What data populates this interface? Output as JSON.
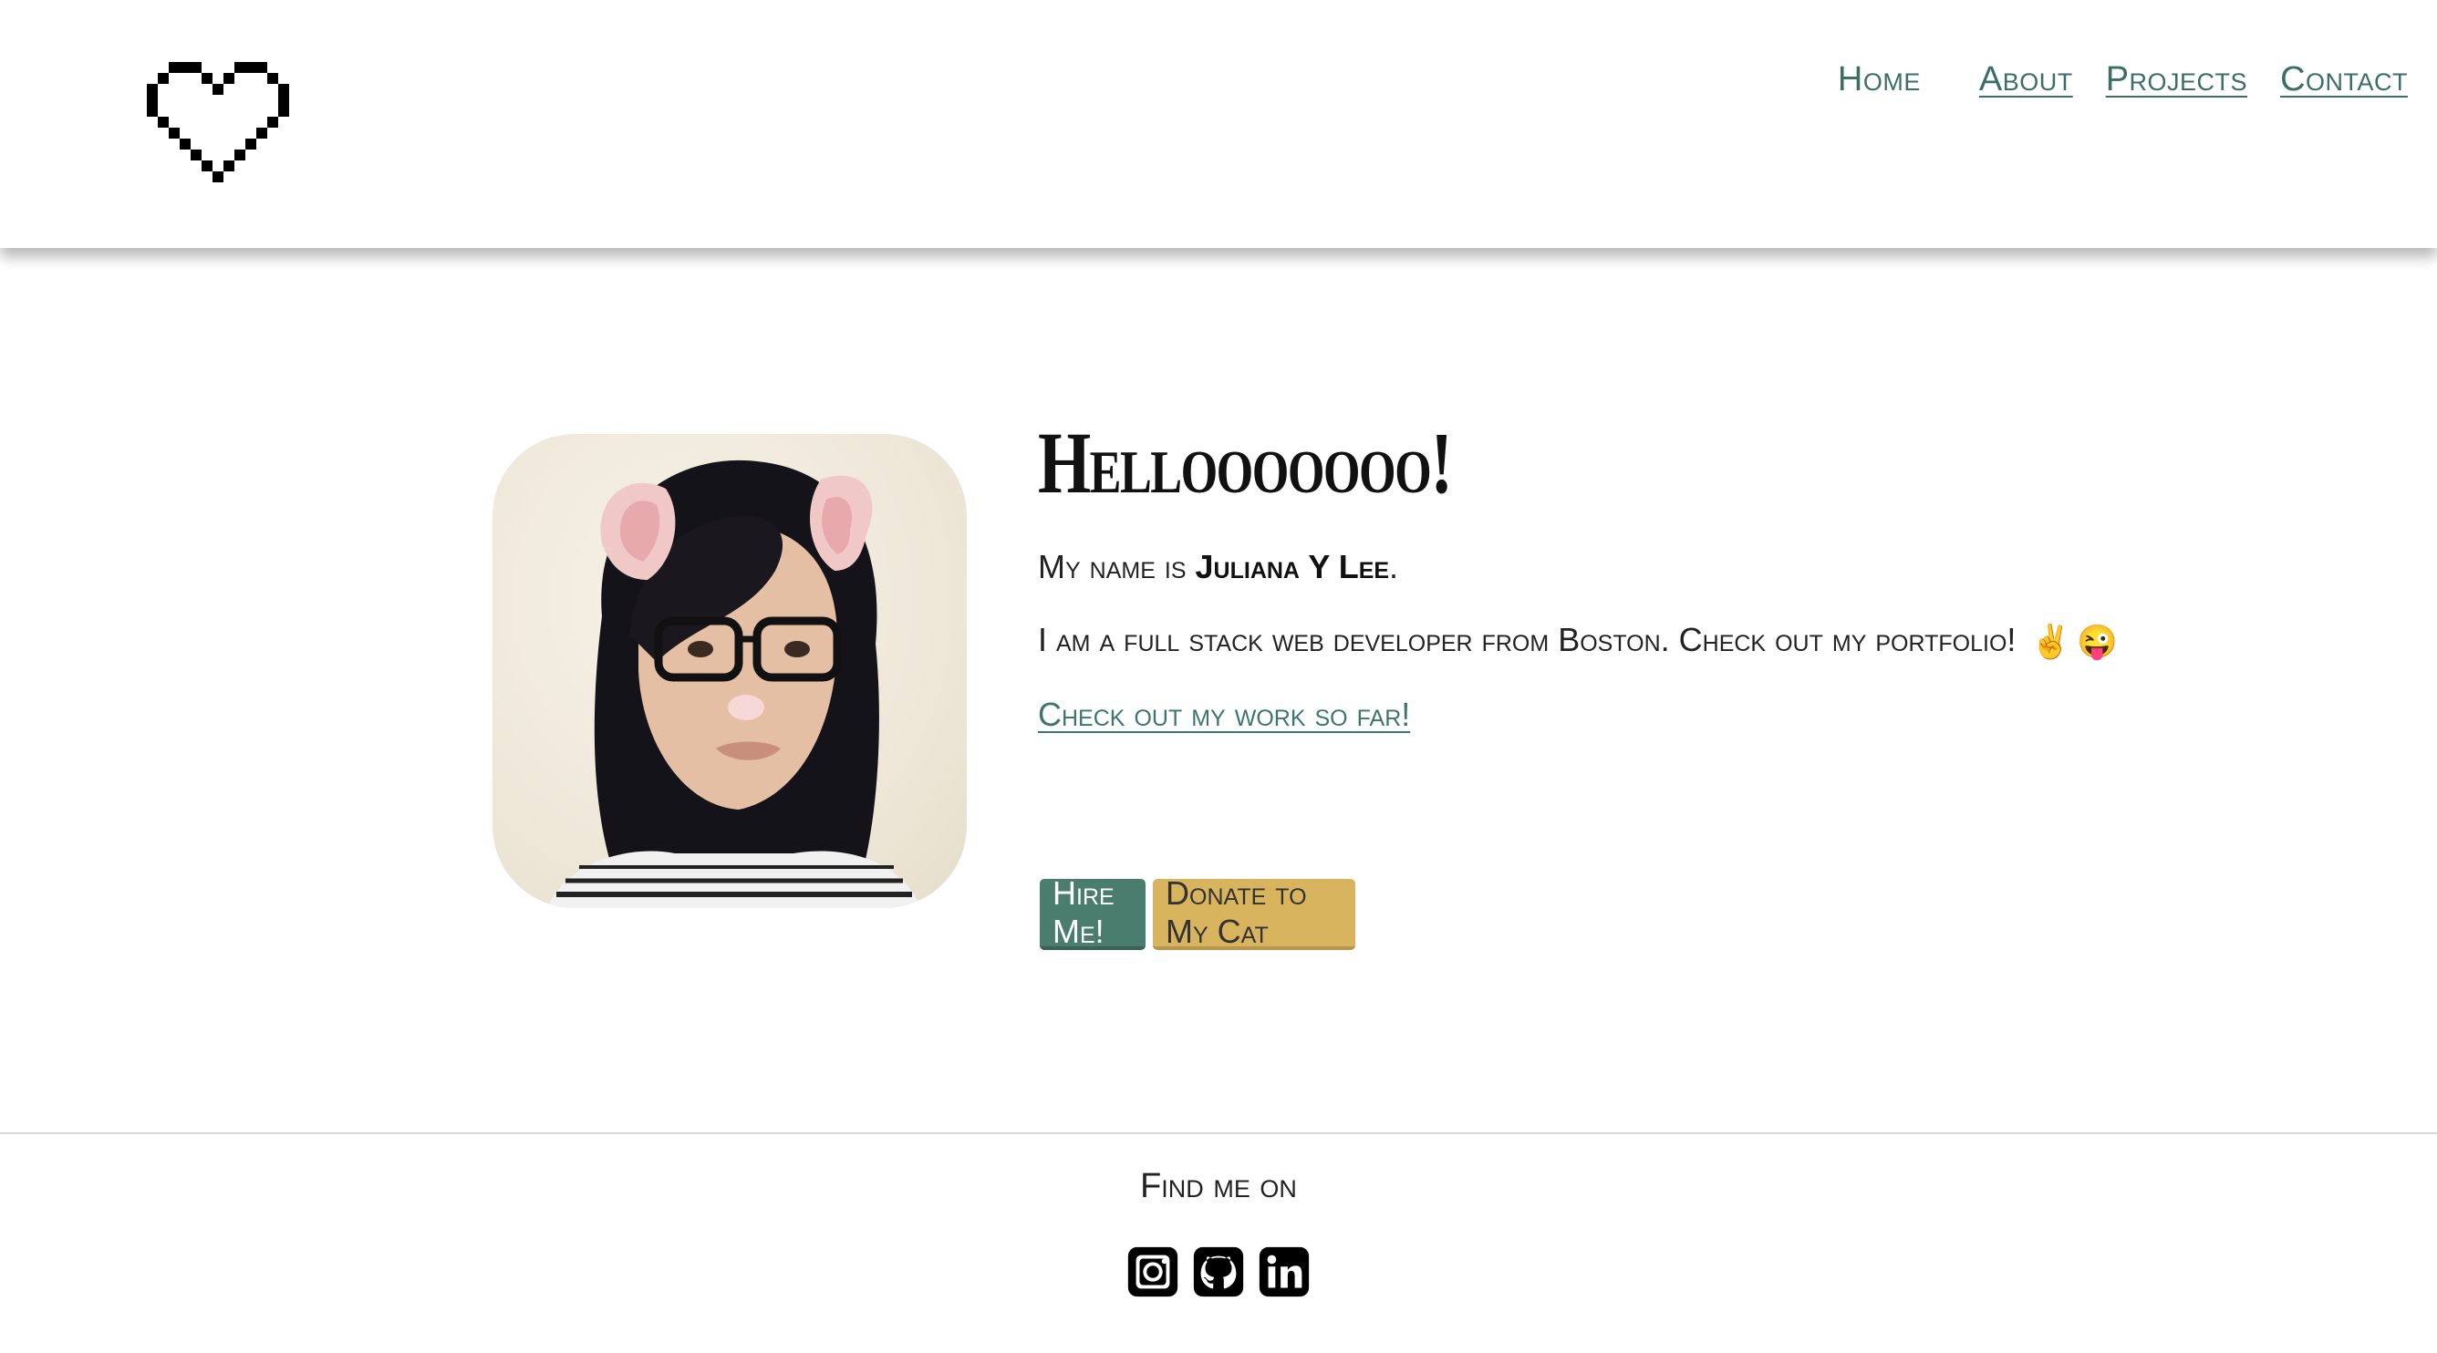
{
  "nav": {
    "logo_icon": "pixel-heart-icon",
    "links": [
      {
        "label": "Home"
      },
      {
        "label": "About"
      },
      {
        "label": "Projects"
      },
      {
        "label": "Contact"
      }
    ]
  },
  "hero": {
    "avatar_icon": "profile-photo",
    "heading": "Hellooooooo!",
    "name_prefix": "My name is ",
    "name": "Juliana Y Lee",
    "name_suffix": ".",
    "intro": "I am a full stack web developer from Boston. Check out my portfolio!",
    "emojis": [
      "✌️",
      "😜"
    ],
    "work_link": "Check out my work so far!",
    "buttons": {
      "hire": "Hire Me!",
      "donate": "Donate to My Cat"
    }
  },
  "footer": {
    "find_me": "Find me on",
    "social": [
      "instagram-icon",
      "github-icon",
      "linkedin-icon"
    ]
  },
  "colors": {
    "link": "#3d6d67",
    "hire_button": "#4b7d6f",
    "donate_button": "#d9b45f"
  }
}
